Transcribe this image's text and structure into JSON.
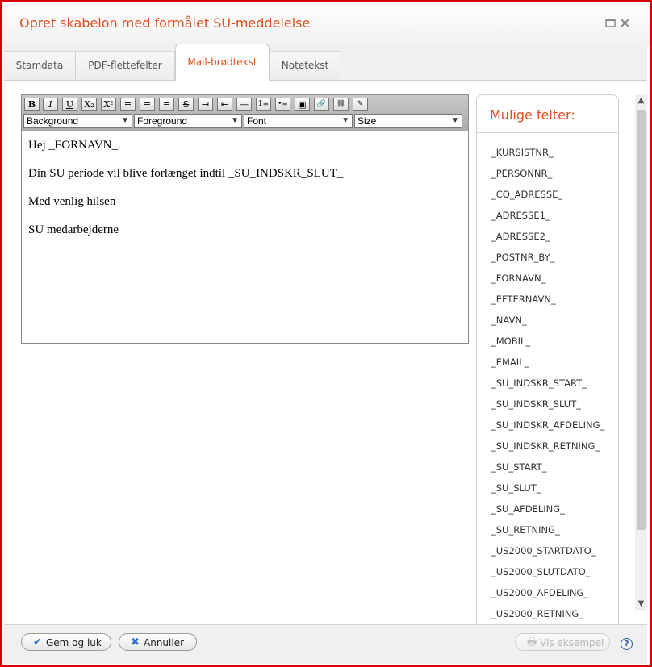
{
  "dialog": {
    "title": "Opret skabelon med formålet SU-meddelelse",
    "maximize_icon": "maximize-icon",
    "close_icon": "close-icon"
  },
  "tabs": [
    {
      "label": "Stamdata",
      "active": false
    },
    {
      "label": "PDF-flettefelter",
      "active": false
    },
    {
      "label": "Mail-brødtekst",
      "active": true
    },
    {
      "label": "Notetekst",
      "active": false
    }
  ],
  "toolbar": {
    "buttons": [
      "B",
      "I",
      "U",
      "X₂",
      "X²",
      "≡",
      "≡",
      "≡",
      "S",
      "⇥",
      "⇤",
      "—",
      "1≡",
      "•≡",
      "▣",
      "🔗",
      "⛓",
      "✎"
    ],
    "selects": {
      "background": "Background",
      "foreground": "Foreground",
      "font": "Font",
      "size": "Size"
    }
  },
  "editor": {
    "lines": [
      "Hej _FORNAVN_",
      "Din SU periode vil blive forlænget indtil _SU_INDSKR_SLUT_",
      "Med venlig hilsen",
      "SU medarbejderne"
    ]
  },
  "fields": {
    "title": "Mulige felter:",
    "items": [
      "_KURSISTNR_",
      "_PERSONNR_",
      "_CO_ADRESSE_",
      "_ADRESSE1_",
      "_ADRESSE2_",
      "_POSTNR_BY_",
      "_FORNAVN_",
      "_EFTERNAVN_",
      "_NAVN_",
      "_MOBIL_",
      "_EMAIL_",
      "_SU_INDSKR_START_",
      "_SU_INDSKR_SLUT_",
      "_SU_INDSKR_AFDELING_",
      "_SU_INDSKR_RETNING_",
      "_SU_START_",
      "_SU_SLUT_",
      "_SU_AFDELING_",
      "_SU_RETNING_",
      "_US2000_STARTDATO_",
      "_US2000_SLUTDATO_",
      "_US2000_AFDELING_",
      "_US2000_RETNING_"
    ]
  },
  "footer": {
    "save_label": "Gem og luk",
    "cancel_label": "Annuller",
    "preview_label": "Vis eksempel",
    "help": "?"
  },
  "colors": {
    "accent": "#e0501e",
    "border": "#d40000"
  }
}
